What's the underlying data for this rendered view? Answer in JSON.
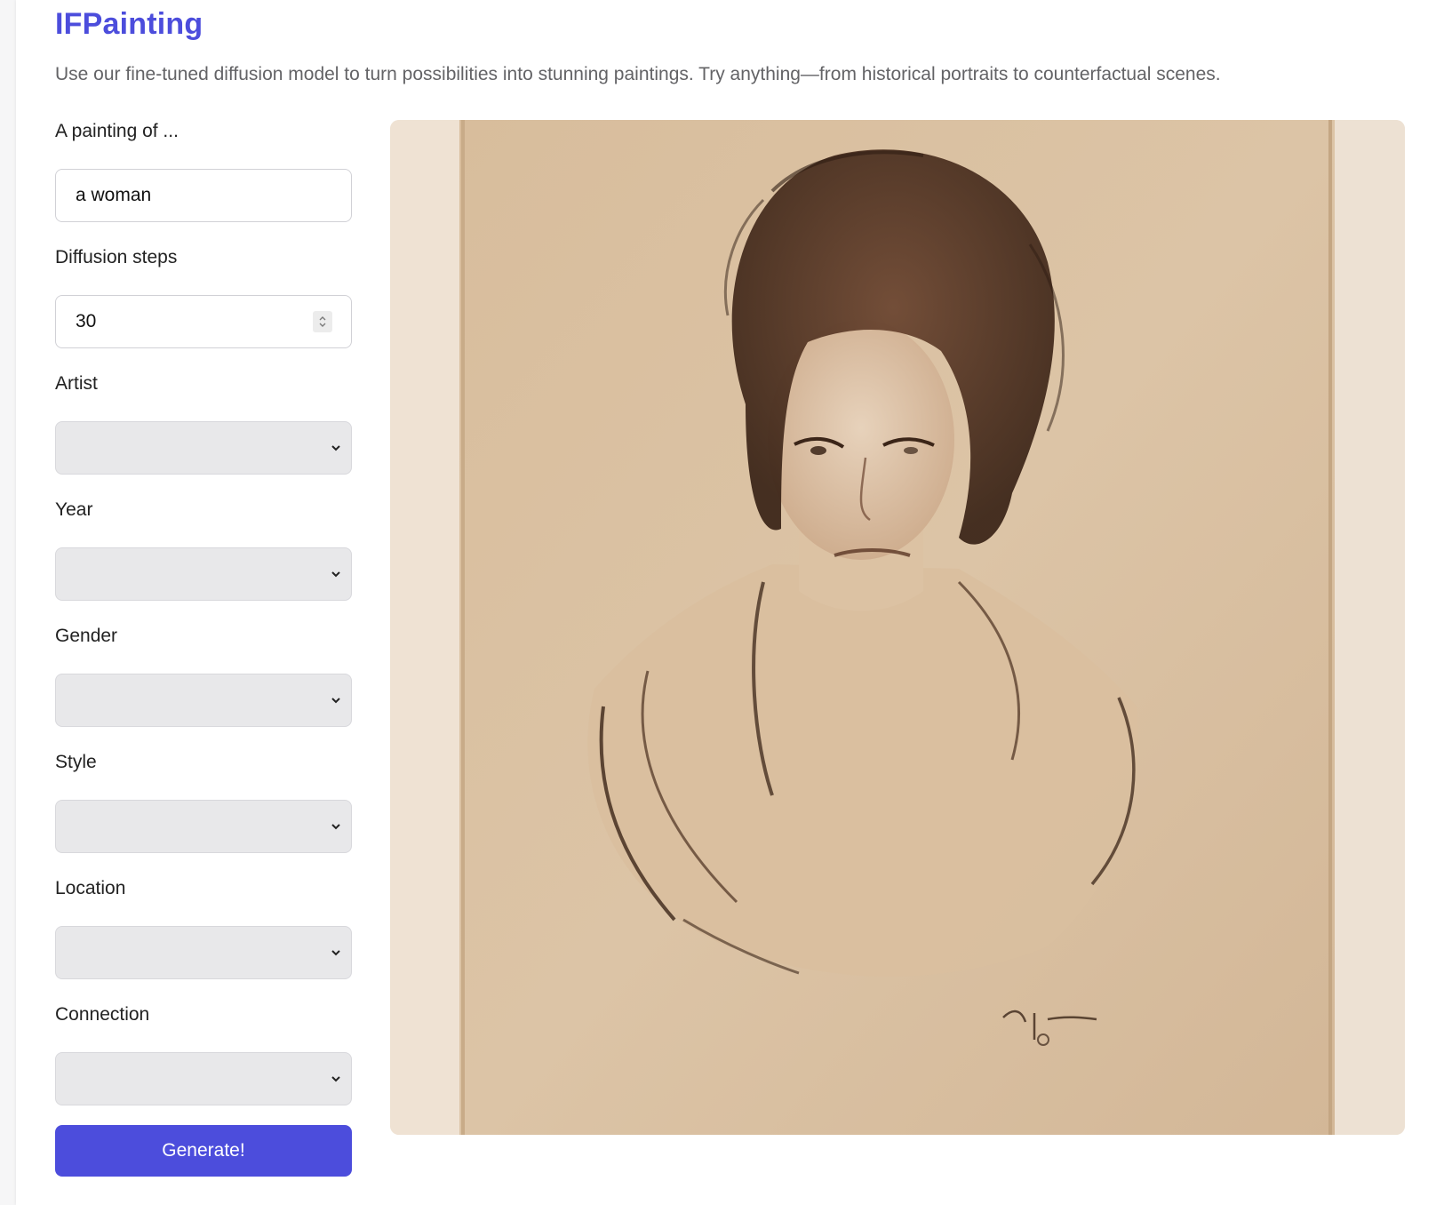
{
  "header": {
    "title": "IFPainting",
    "subtitle": "Use our fine-tuned diffusion model to turn possibilities into stunning paintings. Try anything—from historical portraits to counterfactual scenes."
  },
  "form": {
    "prompt": {
      "label": "A painting of ...",
      "value": "a woman"
    },
    "steps": {
      "label": "Diffusion steps",
      "value": "30"
    },
    "artist": {
      "label": "Artist",
      "value": ""
    },
    "year": {
      "label": "Year",
      "value": ""
    },
    "gender": {
      "label": "Gender",
      "value": ""
    },
    "style": {
      "label": "Style",
      "value": ""
    },
    "location": {
      "label": "Location",
      "value": ""
    },
    "connection": {
      "label": "Connection",
      "value": ""
    },
    "generate_label": "Generate!"
  },
  "colors": {
    "accent": "#4c4ddc",
    "select_bg": "#e8e8ea",
    "paper": "#d9c1a3",
    "ink": "#3b2518"
  },
  "icons": {
    "stepper": "up-down-chevron-icon",
    "select": "chevron-down-icon"
  }
}
